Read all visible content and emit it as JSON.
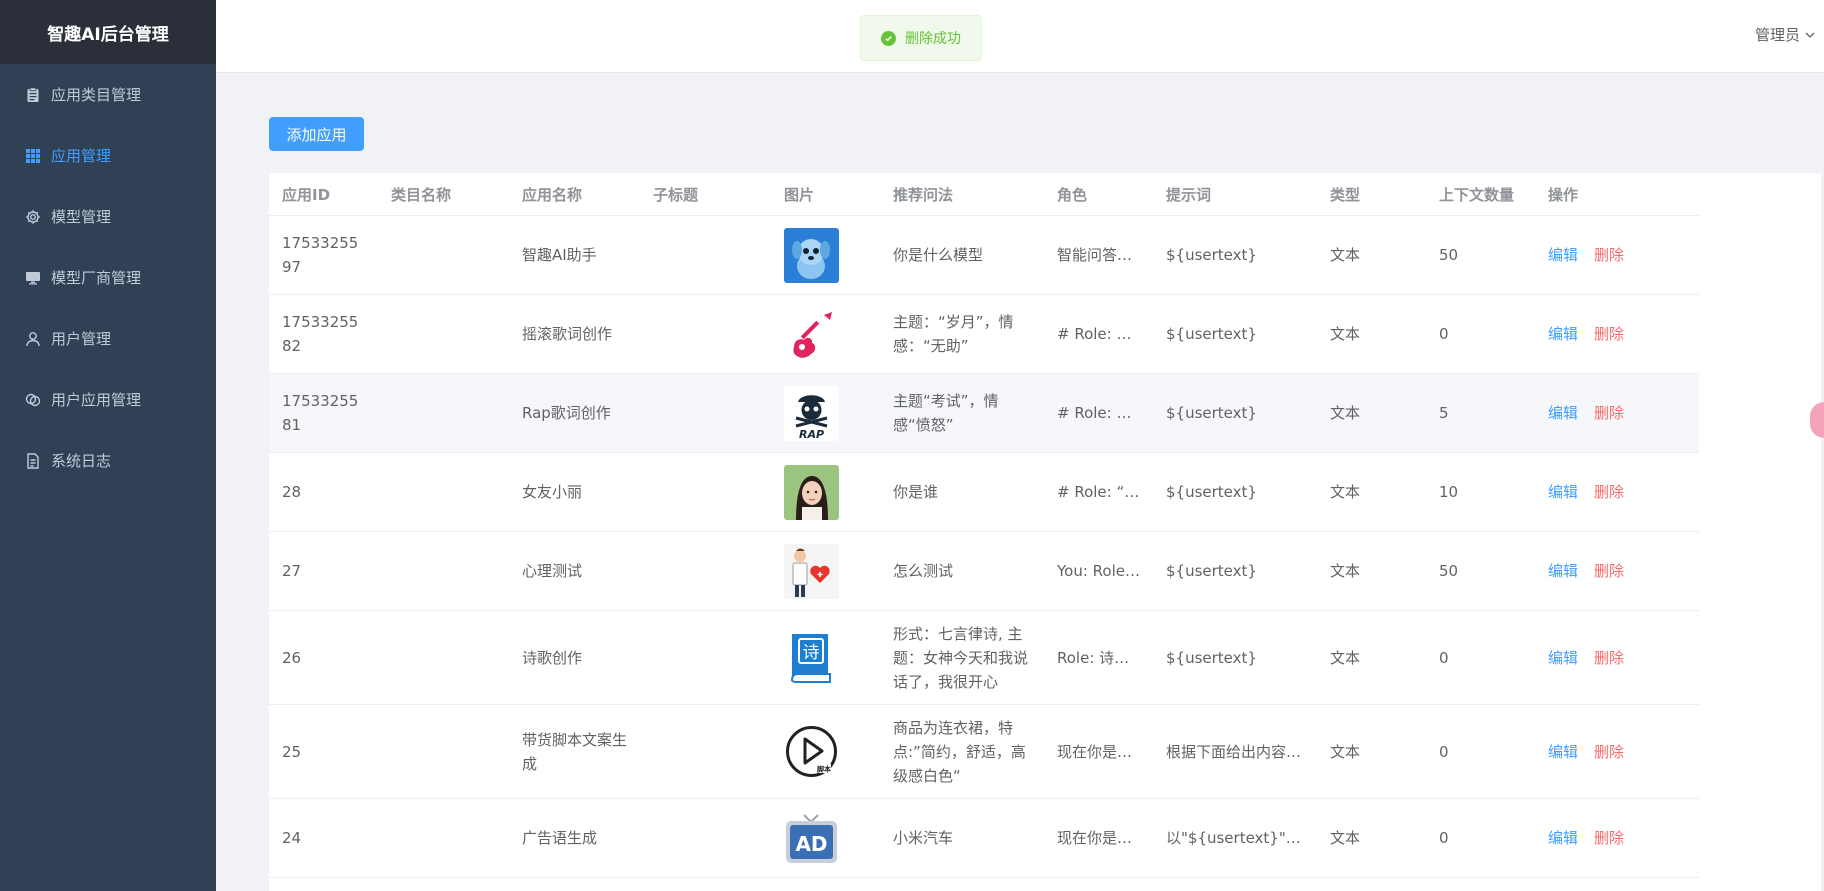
{
  "sidebar": {
    "brand": "智趣AI后台管理",
    "items": [
      {
        "label": "应用类目管理",
        "icon": "clipboard-icon"
      },
      {
        "label": "应用管理",
        "icon": "grid-icon",
        "active": true
      },
      {
        "label": "模型管理",
        "icon": "gear-icon"
      },
      {
        "label": "模型厂商管理",
        "icon": "monitor-icon"
      },
      {
        "label": "用户管理",
        "icon": "user-icon"
      },
      {
        "label": "用户应用管理",
        "icon": "link-icon"
      },
      {
        "label": "系统日志",
        "icon": "document-icon"
      }
    ]
  },
  "header": {
    "admin_label": "管理员"
  },
  "toast": {
    "message": "删除成功"
  },
  "toolbar": {
    "add_label": "添加应用"
  },
  "table": {
    "columns": [
      "应用ID",
      "类目名称",
      "应用名称",
      "子标题",
      "图片",
      "推荐问法",
      "角色",
      "提示词",
      "类型",
      "上下文数量",
      "操作"
    ],
    "actions": {
      "edit": "编辑",
      "delete": "删除"
    },
    "rows": [
      {
        "id": "1753325597",
        "category": "",
        "name": "智趣AI助手",
        "subtitle": "",
        "image": "dog-avatar",
        "question": "你是什么模型",
        "role": "智能问答…",
        "prompt": "${usertext}",
        "type": "文本",
        "context": "50"
      },
      {
        "id": "1753325582",
        "category": "",
        "name": "摇滚歌词创作",
        "subtitle": "",
        "image": "guitar",
        "question": "主题：“岁月”，情感：“无助”",
        "role": "# Role: 摇…",
        "prompt": "${usertext}",
        "type": "文本",
        "context": "0"
      },
      {
        "id": "1753325581",
        "category": "",
        "name": "Rap歌词创作",
        "subtitle": "",
        "image": "rap-skull",
        "question": "主题“考试”，情感“愤怒”",
        "role": "# Role: R…",
        "prompt": "${usertext}",
        "type": "文本",
        "context": "5"
      },
      {
        "id": "28",
        "category": "",
        "name": "女友小丽",
        "subtitle": "",
        "image": "girl-photo",
        "question": "你是谁",
        "role": "# Role: “…",
        "prompt": "${usertext}",
        "type": "文本",
        "context": "10"
      },
      {
        "id": "27",
        "category": "",
        "name": "心理测试",
        "subtitle": "",
        "image": "doctor-heart",
        "question": "怎么测试",
        "role": "You: Role…",
        "prompt": "${usertext}",
        "type": "文本",
        "context": "50"
      },
      {
        "id": "26",
        "category": "",
        "name": "诗歌创作",
        "subtitle": "",
        "image": "poem-book",
        "question": "形式：七言律诗, 主题：女神今天和我说话了，我很开心",
        "role": "Role: 诗…",
        "prompt": "${usertext}",
        "type": "文本",
        "context": "0"
      },
      {
        "id": "25",
        "category": "",
        "name": "带货脚本文案生成",
        "subtitle": "",
        "image": "play-script",
        "question": "商品为连衣裙，特点:”简约，舒适，高级感白色“",
        "role": "现在你是…",
        "prompt": "根据下面给出内容…",
        "type": "文本",
        "context": "0"
      },
      {
        "id": "24",
        "category": "",
        "name": "广告语生成",
        "subtitle": "",
        "image": "ad-tv",
        "question": "小米汽车",
        "role": "现在你是…",
        "prompt": "以\"${usertext}\"为…",
        "type": "文本",
        "context": "0"
      }
    ]
  },
  "colors": {
    "sidebar_bg": "#304156",
    "brand_bg": "#2b2f3a",
    "accent": "#409eff",
    "danger": "#f56c6c",
    "success": "#67c23a"
  }
}
